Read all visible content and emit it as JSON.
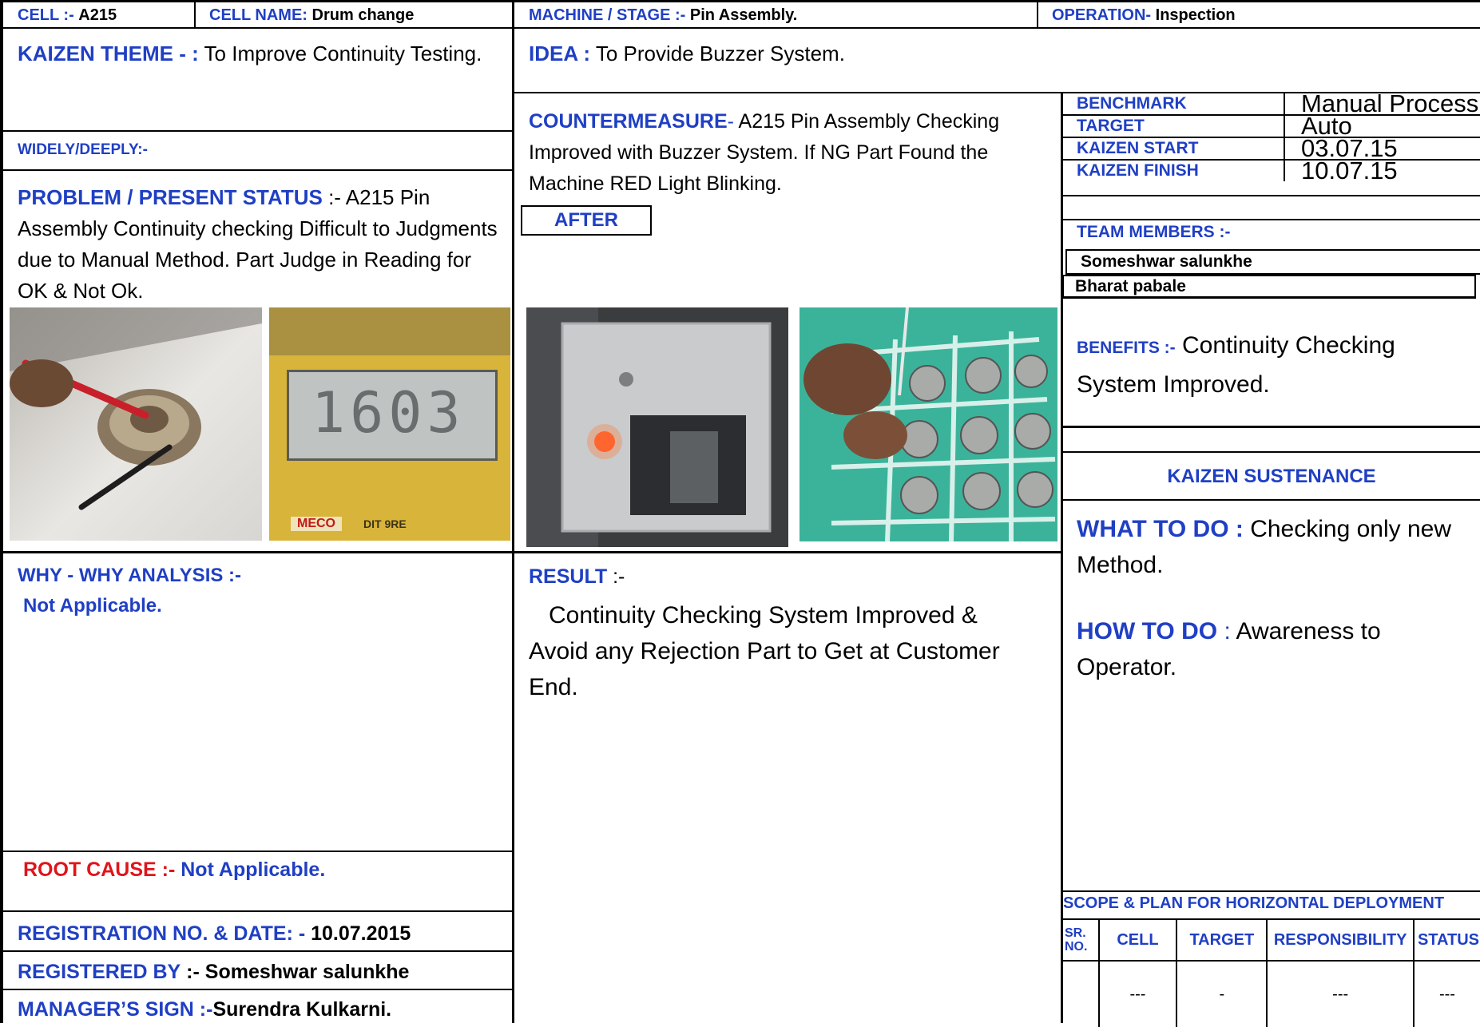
{
  "header": {
    "cell_label": "CELL :-",
    "cell_value": "A215",
    "cell_name_label": "CELL NAME:",
    "cell_name_value": "Drum change",
    "machine_label": "MACHINE / STAGE :-",
    "machine_value": "Pin Assembly.",
    "operation_label": "OPERATION-",
    "operation_value": "Inspection"
  },
  "theme": {
    "label": "KAIZEN THEME - :",
    "text": "To Improve Continuity Testing."
  },
  "idea": {
    "label": "IDEA :",
    "text": "To Provide Buzzer System."
  },
  "widely": {
    "label": "WIDELY/DEEPLY:-"
  },
  "problem": {
    "label": "PROBLEM / PRESENT STATUS",
    "sep": ":-",
    "text": "A215 Pin Assembly Continuity checking Difficult  to Judgments due to Manual Method. Part Judge in Reading for OK & Not Ok.",
    "meter_text": "1603",
    "meter_brand": "meco",
    "meter_model": "DIT 9RE"
  },
  "countermeasure": {
    "label": "COUNTERMEASURE",
    "sep": "-",
    "text": "A215 Pin Assembly Checking Improved with Buzzer System. If NG Part Found the Machine RED Light Blinking.",
    "after_label": "AFTER"
  },
  "info_table": {
    "rows": [
      {
        "label": "BENCHMARK",
        "value": "Manual Process"
      },
      {
        "label": "TARGET",
        "value": "Auto"
      },
      {
        "label": "KAIZEN START",
        "value": "03.07.15"
      },
      {
        "label": "KAIZEN FINISH",
        "value": "10.07.15"
      }
    ]
  },
  "team": {
    "label": "TEAM MEMBERS :-",
    "members": [
      "Someshwar salunkhe",
      "Bharat pabale"
    ]
  },
  "benefits": {
    "label": "BENEFITS :-",
    "text": "Continuity Checking System Improved."
  },
  "sustenance": {
    "title": "KAIZEN SUSTENANCE",
    "what_label": "WHAT TO DO :",
    "what_text": "Checking only new Method.",
    "how_label": "HOW TO DO",
    "how_sep": ":",
    "how_text": "Awareness to Operator."
  },
  "why": {
    "label": "WHY - WHY ANALYSIS :-",
    "text": "Not Applicable."
  },
  "result": {
    "label": "RESULT",
    "sep": ":-",
    "text": "Continuity Checking System Improved & Avoid any Rejection Part to Get at Customer End."
  },
  "root_cause": {
    "label": "ROOT CAUSE :-",
    "text": "Not Applicable."
  },
  "registration": {
    "label": "REGISTRATION NO. & DATE: -",
    "value": "10.07.2015"
  },
  "registered_by": {
    "label": "REGISTERED BY",
    "sep": ":-",
    "value": "Someshwar salunkhe"
  },
  "manager": {
    "label": "MANAGER’S SIGN :-",
    "value": "Surendra Kulkarni."
  },
  "scope": {
    "title": "SCOPE & PLAN FOR HORIZONTAL DEPLOYMENT",
    "headers": [
      "SR. NO.",
      "CELL",
      "TARGET",
      "RESPONSIBILITY",
      "STATUS"
    ],
    "row": [
      "",
      "---",
      "-",
      "---",
      "---"
    ]
  }
}
